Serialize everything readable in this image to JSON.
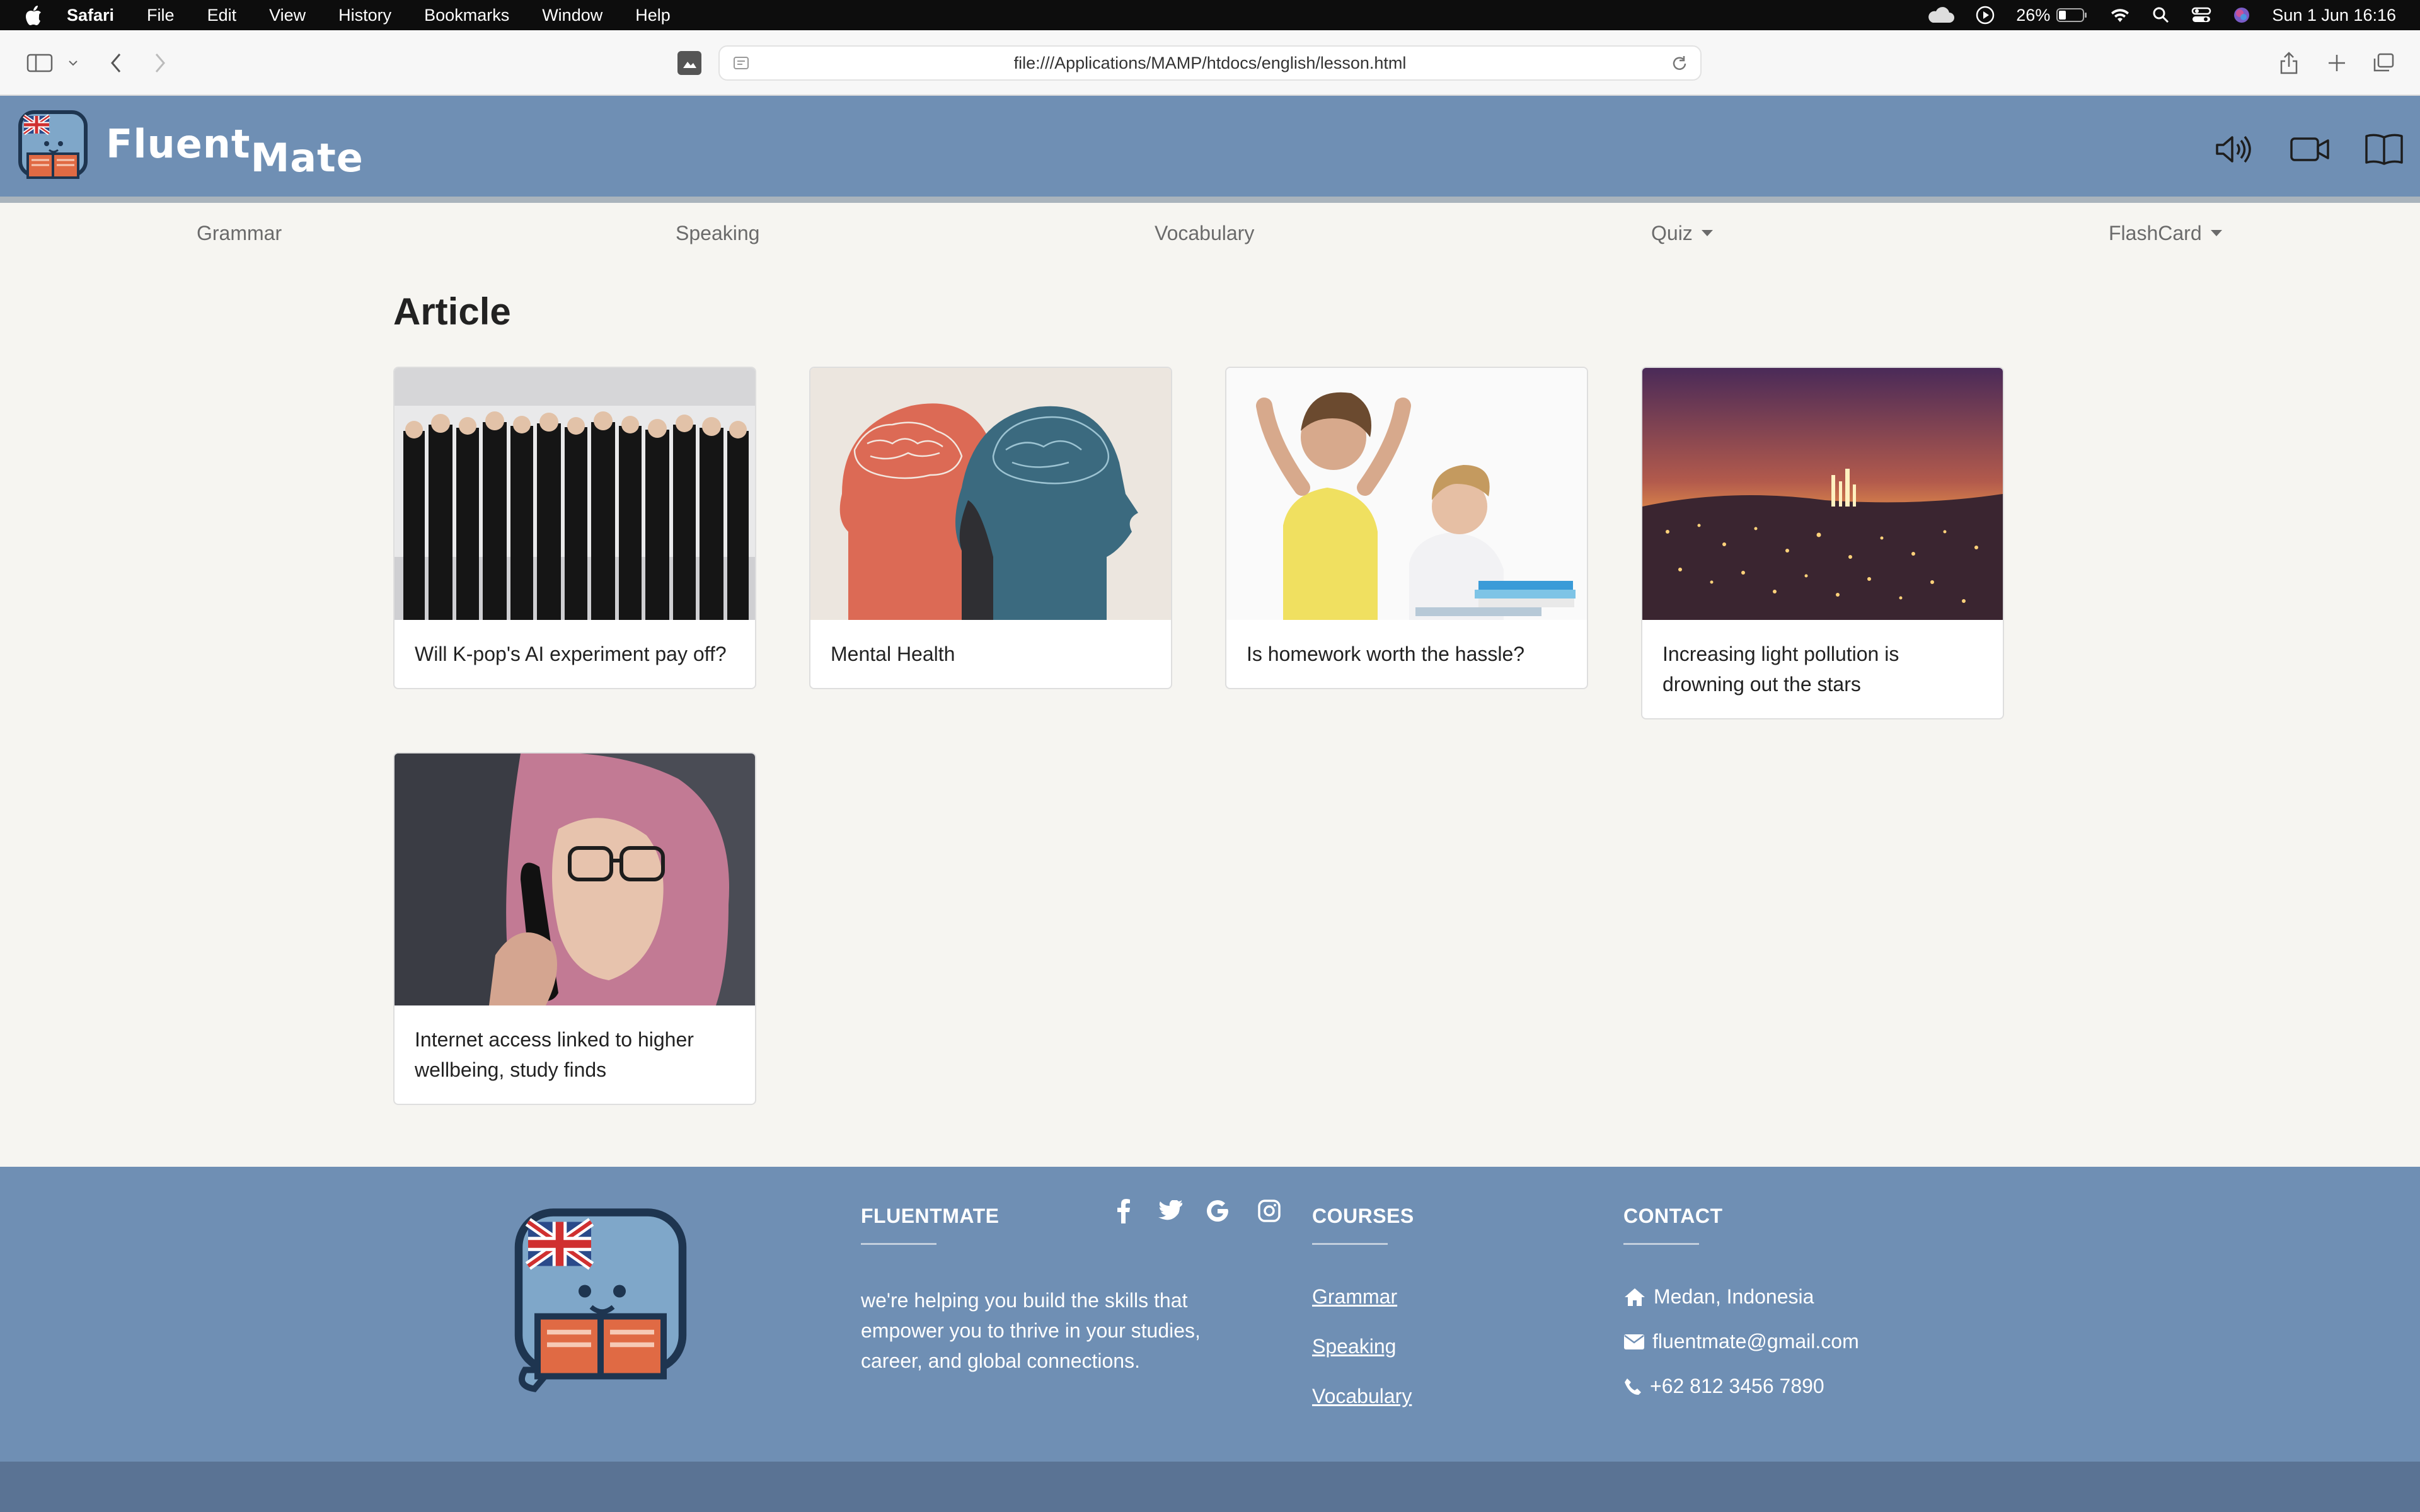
{
  "menubar": {
    "app": "Safari",
    "items": [
      "File",
      "Edit",
      "View",
      "History",
      "Bookmarks",
      "Window",
      "Help"
    ],
    "battery": "26%",
    "datetime": "Sun 1 Jun  16:16"
  },
  "browser": {
    "url": "file:///Applications/MAMP/htdocs/english/lesson.html"
  },
  "site": {
    "brand_part1": "Fluent",
    "brand_part2": "Mate",
    "header_icons": [
      "speaker-icon",
      "video-icon",
      "book-icon"
    ],
    "accent_color": "#6f8fb4"
  },
  "nav": {
    "items": [
      {
        "label": "Grammar"
      },
      {
        "label": "Speaking"
      },
      {
        "label": "Vocabulary"
      },
      {
        "label": "Quiz",
        "dropdown": true
      },
      {
        "label": "FlashCard",
        "dropdown": true
      }
    ]
  },
  "main": {
    "title": "Article",
    "cards": [
      {
        "caption": "Will K-pop's AI experiment pay off?"
      },
      {
        "caption": "Mental Health"
      },
      {
        "caption": "Is homework worth the hassle?"
      },
      {
        "caption": "Increasing light pollution is drowning out the stars"
      },
      {
        "caption": "Internet access linked to higher wellbeing, study finds"
      }
    ]
  },
  "footer": {
    "about": {
      "heading": "FLUENTMATE",
      "text": "we're helping you build the skills that empower you to thrive in your studies, career, and global connections."
    },
    "courses": {
      "heading": "COURSES",
      "links": [
        "Grammar",
        "Speaking",
        "Vocabulary"
      ]
    },
    "contact": {
      "heading": "CONTACT",
      "location": "Medan, Indonesia",
      "email": "fluentmate@gmail.com",
      "phone": "+62 812 3456 7890"
    },
    "social_icons": [
      "facebook-icon",
      "twitter-icon",
      "google-icon",
      "instagram-icon"
    ]
  }
}
